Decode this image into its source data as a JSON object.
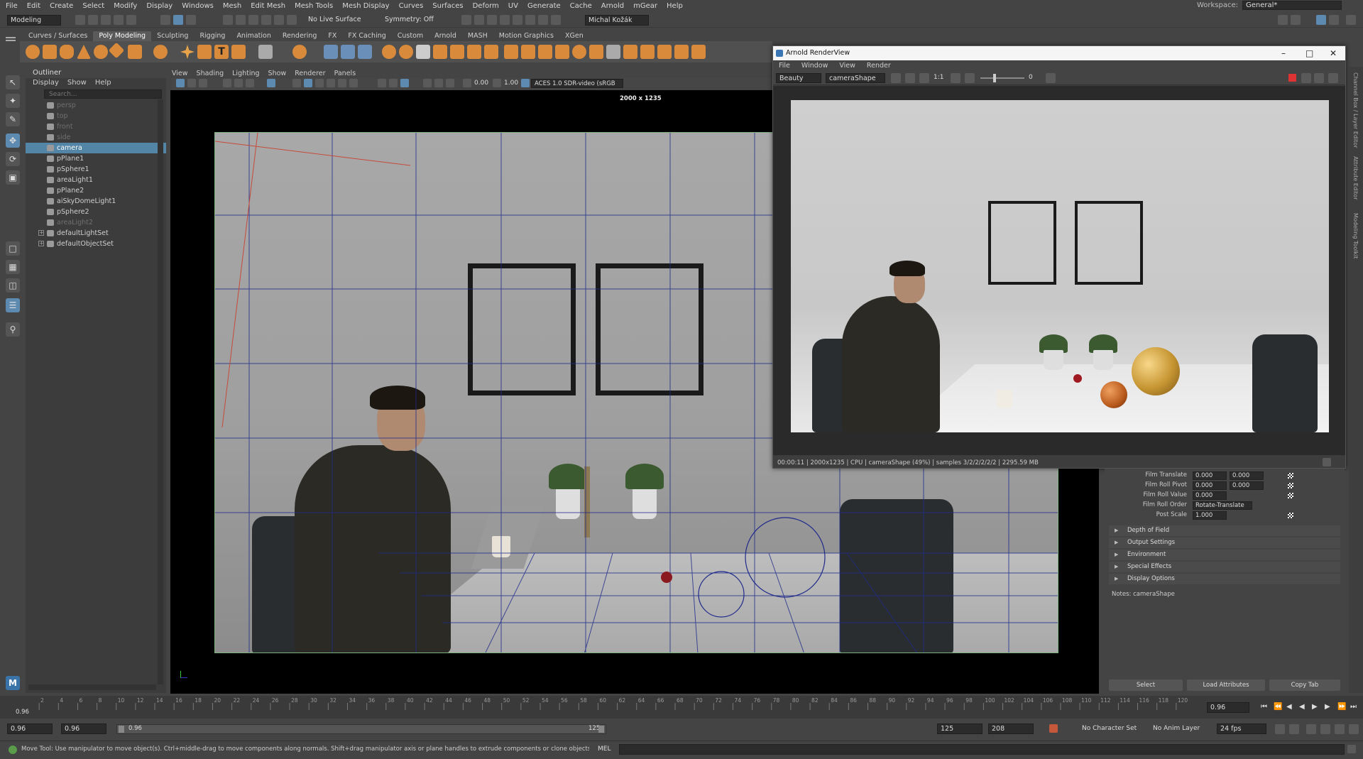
{
  "menubar": {
    "items": [
      "File",
      "Edit",
      "Create",
      "Select",
      "Modify",
      "Display",
      "Windows",
      "Mesh",
      "Edit Mesh",
      "Mesh Tools",
      "Mesh Display",
      "Curves",
      "Surfaces",
      "Deform",
      "UV",
      "Generate",
      "Cache",
      "Arnold",
      "mGear",
      "Help"
    ],
    "workspace_label": "Workspace:",
    "workspace_value": "General*"
  },
  "statusline": {
    "mode": "Modeling",
    "live_surface": "No Live Surface",
    "symmetry": "Symmetry: Off",
    "user": "Michal Kožák"
  },
  "shelf": {
    "tabs": [
      "Curves / Surfaces",
      "Poly Modeling",
      "Sculpting",
      "Rigging",
      "Animation",
      "Rendering",
      "FX",
      "FX Caching",
      "Custom",
      "Arnold",
      "MASH",
      "Motion Graphics",
      "XGen"
    ],
    "active_tab": "Poly Modeling"
  },
  "outliner": {
    "title": "Outliner",
    "menu": [
      "Display",
      "Show",
      "Help"
    ],
    "search_placeholder": "Search...",
    "items": [
      {
        "label": "persp",
        "state": "dim"
      },
      {
        "label": "top",
        "state": "dim"
      },
      {
        "label": "front",
        "state": "dim"
      },
      {
        "label": "side",
        "state": "dim"
      },
      {
        "label": "camera",
        "state": "selected"
      },
      {
        "label": "pPlane1",
        "state": "normal"
      },
      {
        "label": "pSphere1",
        "state": "normal"
      },
      {
        "label": "areaLight1",
        "state": "normal"
      },
      {
        "label": "pPlane2",
        "state": "normal"
      },
      {
        "label": "aiSkyDomeLight1",
        "state": "normal"
      },
      {
        "label": "pSphere2",
        "state": "normal"
      },
      {
        "label": "areaLight2",
        "state": "dim"
      },
      {
        "label": "defaultLightSet",
        "state": "normal"
      },
      {
        "label": "defaultObjectSet",
        "state": "normal"
      }
    ]
  },
  "viewport": {
    "menu": [
      "View",
      "Shading",
      "Lighting",
      "Show",
      "Renderer",
      "Panels"
    ],
    "exposure": "0.00",
    "gamma": "1.00",
    "color_space": "ACES 1.0 SDR-video (sRGB",
    "resolution_label": "2000 x 1235"
  },
  "render_view": {
    "title": "Arnold RenderView",
    "menu": [
      "File",
      "Window",
      "View",
      "Render"
    ],
    "aov": "Beauty",
    "camera": "cameraShape",
    "ratio": "1:1",
    "slider_value": "0",
    "status": "00:00:11 | 2000x1235 | CPU | cameraShape (49%) | samples 3/2/2/2/2/2 | 2295.59 MB"
  },
  "attribute_editor": {
    "rows": [
      {
        "label": "Film Translate",
        "v1": "0.000",
        "v2": "0.000"
      },
      {
        "label": "Film Roll Pivot",
        "v1": "0.000",
        "v2": "0.000"
      },
      {
        "label": "Film Roll Value",
        "v1": "0.000",
        "v2": ""
      },
      {
        "label": "Film Roll Order",
        "v1": "Rotate-Translate",
        "v2": ""
      },
      {
        "label": "Post Scale",
        "v1": "1.000",
        "v2": ""
      }
    ],
    "sections": [
      "Depth of Field",
      "Output Settings",
      "Environment",
      "Special Effects",
      "Display Options"
    ],
    "notes": "Notes: cameraShape",
    "buttons": {
      "select": "Select",
      "load": "Load Attributes",
      "copy": "Copy Tab"
    }
  },
  "right_strip": [
    "Channel Box / Layer Editor",
    "Attribute Editor",
    "Modeling Toolkit"
  ],
  "timeline": {
    "ticks": [
      "2",
      "4",
      "6",
      "8",
      "10",
      "12",
      "14",
      "16",
      "18",
      "20",
      "22",
      "24",
      "26",
      "28",
      "30",
      "32",
      "34",
      "36",
      "38",
      "40",
      "42",
      "44",
      "46",
      "48",
      "50",
      "52",
      "54",
      "56",
      "58",
      "60",
      "62",
      "64",
      "66",
      "68",
      "70",
      "72",
      "74",
      "76",
      "78",
      "80",
      "82",
      "84",
      "86",
      "88",
      "90",
      "92",
      "94",
      "96",
      "98",
      "100",
      "102",
      "104",
      "106",
      "108",
      "110",
      "112",
      "114",
      "116",
      "118",
      "120"
    ],
    "current_left": "0.96",
    "current_field": "0.96"
  },
  "range": {
    "start": "0.96",
    "start2": "0.96",
    "slider_start": "0.96",
    "slider_end": "125",
    "end": "125",
    "end2": "208",
    "character_set": "No Character Set",
    "anim_layer": "No Anim Layer",
    "fps": "24 fps"
  },
  "helpline": {
    "text": "Move Tool: Use manipulator to move object(s). Ctrl+middle-drag to move components along normals. Shift+drag manipulator axis or plane handles to extrude components or clone objects. Ctrl+Shift+drag to constrain movement to a co",
    "lang": "MEL"
  },
  "colors": {
    "accent": "#5285a6",
    "shelf_orange": "#d98a3a",
    "gate": "#7fb27f",
    "grid": "#1f2a8a"
  }
}
